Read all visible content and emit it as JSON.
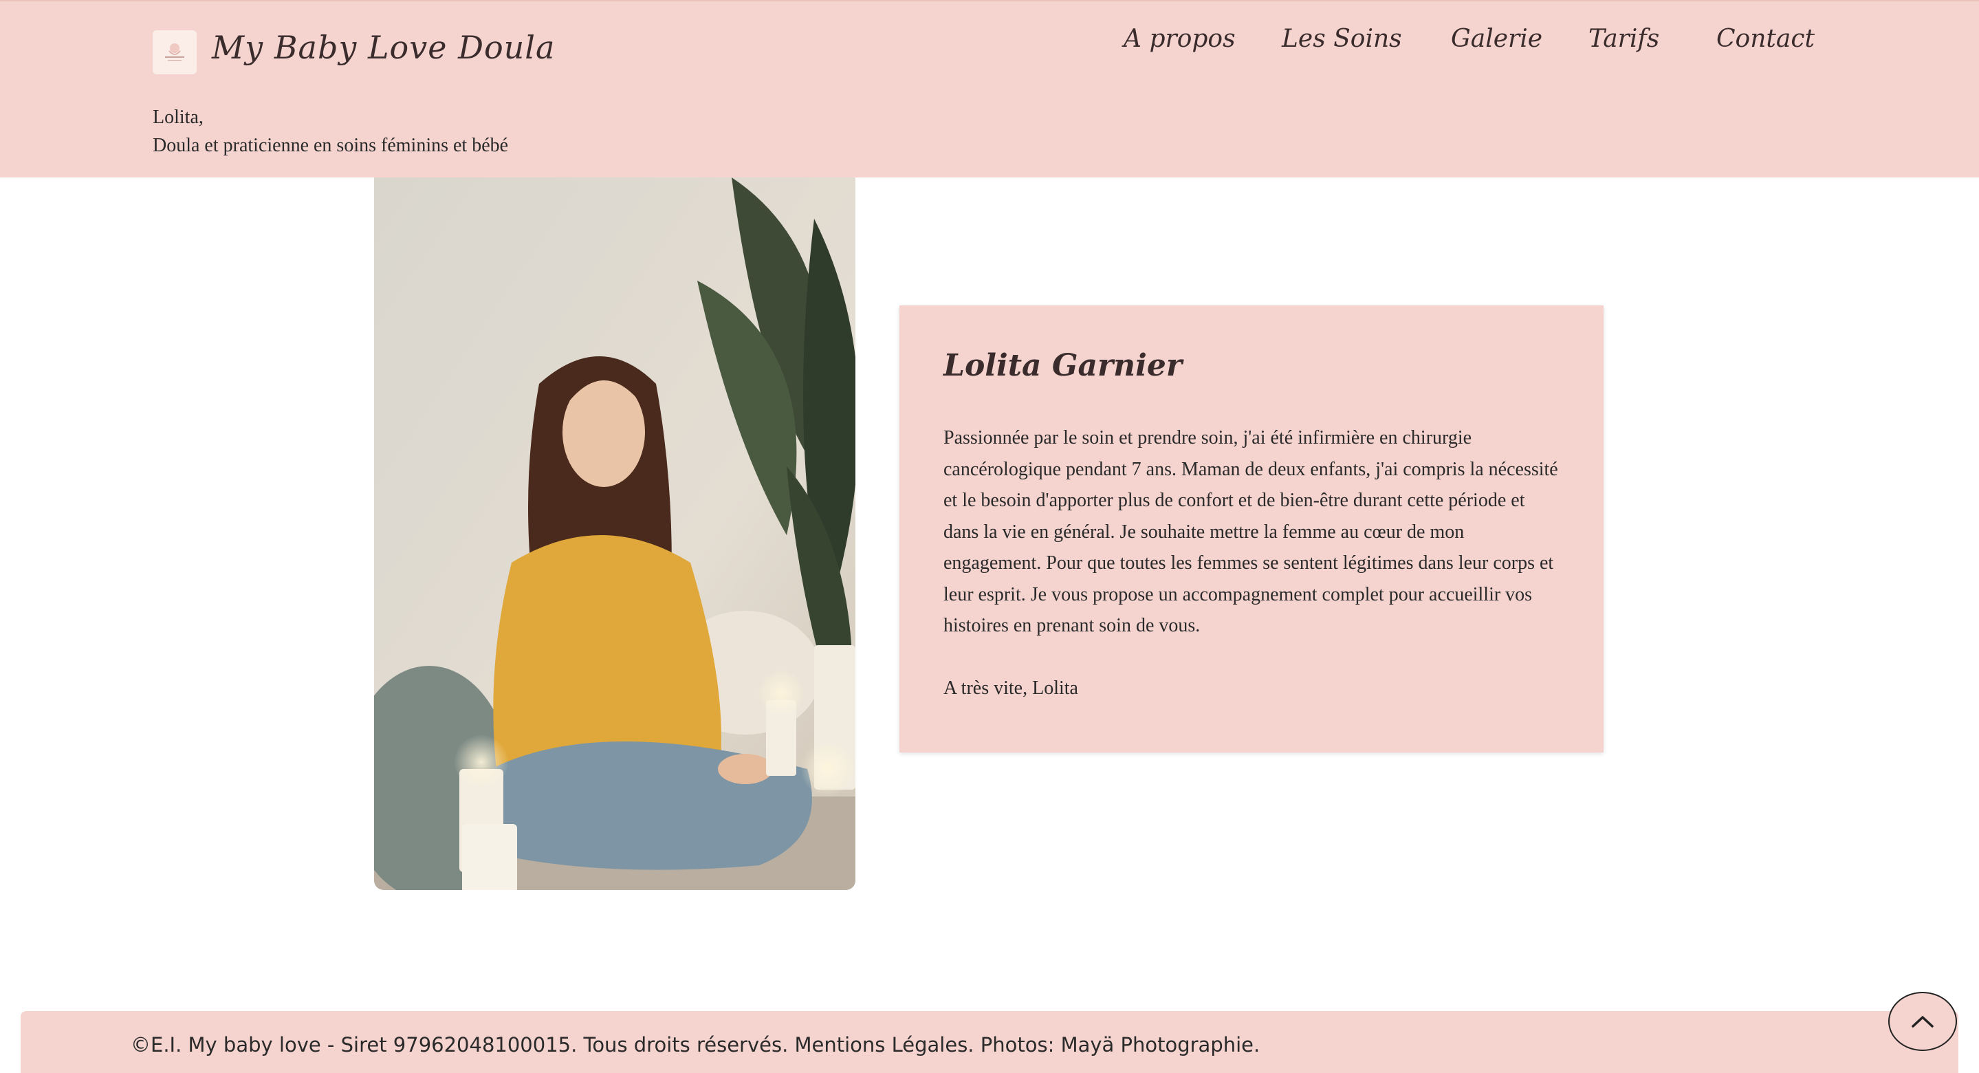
{
  "header": {
    "site_title": "My Baby Love Doula",
    "logo_icon": "baby-love-logo-icon",
    "nav": [
      {
        "label": "A propos"
      },
      {
        "label": "Les Soins"
      },
      {
        "label": "Galerie"
      },
      {
        "label": "Tarifs"
      },
      {
        "label": "Contact"
      }
    ],
    "tagline_line1": "Lolita,",
    "tagline_line2": "Doula et praticienne en soins féminins et bébé"
  },
  "bio": {
    "name": "Lolita Garnier",
    "text": "Passionnée par le soin et prendre soin, j'ai été infirmière en chirurgie cancérologique pendant 7 ans. Maman de deux enfants, j'ai compris la nécessité et le besoin d'apporter plus de confort et de bien-être durant cette période et dans la vie en général. Je souhaite mettre la femme au cœur de mon engagement. Pour que toutes les femmes se sentent légitimes dans leur corps et leur esprit. Je vous propose un accompagnement complet pour accueillir vos histoires en prenant soin de vous.",
    "signature": "A très vite, Lolita"
  },
  "footer": {
    "text": "©E.I. My baby love - Siret 97962048100015. Tous droits réservés. Mentions Légales. Photos: Mayä Photographie."
  },
  "scroll_top": {
    "icon": "chevron-up-icon"
  },
  "colors": {
    "brand_pink": "#f5d4cf",
    "text_dark": "#2a2a2a",
    "title_dark": "#3a2c2c"
  }
}
